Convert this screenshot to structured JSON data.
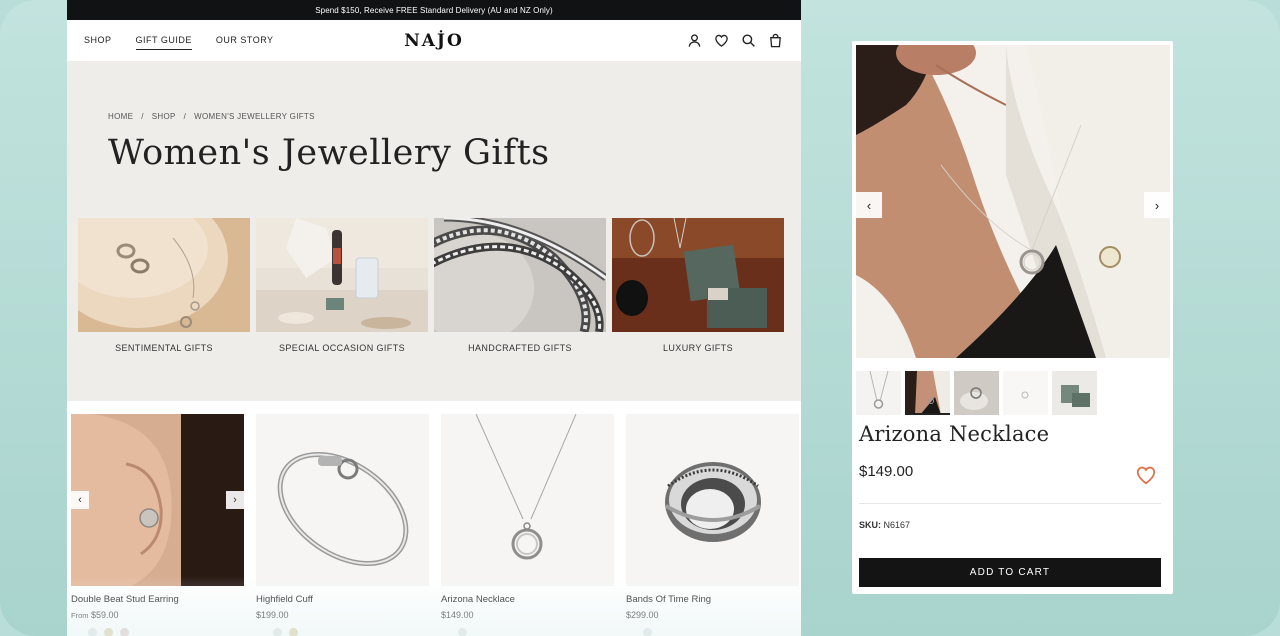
{
  "promo_bar": {
    "text": "Spend $150, Receive FREE Standard Delivery (AU and NZ Only)"
  },
  "nav": {
    "links": [
      "SHOP",
      "GIFT GUIDE",
      "OUR STORY"
    ],
    "active": "GIFT GUIDE",
    "logo": "NAJO",
    "icons": [
      "account-icon",
      "wishlist-heart-icon",
      "search-icon",
      "shopping-bag-icon"
    ]
  },
  "breadcrumb": {
    "items": [
      "HOME",
      "SHOP",
      "WOMEN'S JEWELLERY GIFTS"
    ],
    "separator": "/"
  },
  "page_title": "Women's Jewellery Gifts",
  "categories": [
    {
      "label": "SENTIMENTAL GIFTS"
    },
    {
      "label": "SPECIAL OCCASION GIFTS"
    },
    {
      "label": "HANDCRAFTED GIFTS"
    },
    {
      "label": "LUXURY GIFTS"
    }
  ],
  "products": [
    {
      "name": "Double Beat Stud Earring",
      "price_prefix": "From",
      "price": "$59.00",
      "swatch_colors": [
        "#d9dde2",
        "#d8c79a",
        "#dcc1c0"
      ]
    },
    {
      "name": "Highfield Cuff",
      "price_prefix": "",
      "price": "$199.00",
      "swatch_colors": [
        "#d9dde2",
        "#d8c79a"
      ]
    },
    {
      "name": "Arizona Necklace",
      "price_prefix": "",
      "price": "$149.00",
      "swatch_colors": [
        "#d9dde2"
      ]
    },
    {
      "name": "Bands Of Time Ring",
      "price_prefix": "",
      "price": "$299.00",
      "swatch_colors": [
        "#d9dde2"
      ]
    }
  ],
  "detail": {
    "title": "Arizona Necklace",
    "price": "$149.00",
    "sku_label": "SKU:",
    "sku_value": "N6167",
    "add_to_cart": "ADD TO CART",
    "thumbnail_count": 5,
    "active_thumbnail": 2
  },
  "colors": {
    "accent_heart": "#e0724a",
    "dark": "#141414",
    "hero_bg": "#efedea",
    "frame_bg": "#b9ddd8"
  }
}
